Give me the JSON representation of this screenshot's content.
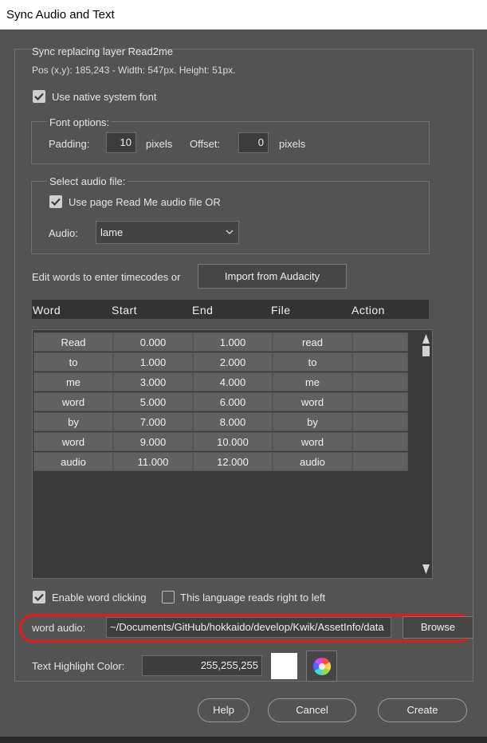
{
  "window": {
    "title": "Sync Audio and Text"
  },
  "layer_info": {
    "title": "Sync replacing layer Read2me",
    "position": "Pos (x,y): 185,243 - Width: 547px. Height: 51px."
  },
  "native_font": {
    "label": "Use native system font",
    "checked": true
  },
  "font_options": {
    "title": "Font options:",
    "padding_label": "Padding:",
    "padding_value": "10",
    "padding_unit": "pixels",
    "offset_label": "Offset:",
    "offset_value": "0",
    "offset_unit": "pixels"
  },
  "audio_file": {
    "title": "Select audio file:",
    "use_page_label": "Use page Read Me audio file OR",
    "use_page_checked": true,
    "audio_label": "Audio:",
    "audio_value": "lame"
  },
  "edit_words": {
    "label": "Edit words to enter timecodes or",
    "import_button": "Import from Audacity"
  },
  "table": {
    "columns": [
      "Word",
      "Start",
      "End",
      "File",
      "Action"
    ],
    "rows": [
      [
        "Read",
        "0.000",
        "1.000",
        "read",
        ""
      ],
      [
        "to",
        "1.000",
        "2.000",
        "to",
        ""
      ],
      [
        "me",
        "3.000",
        "4.000",
        "me",
        ""
      ],
      [
        "word",
        "5.000",
        "6.000",
        "word",
        ""
      ],
      [
        "by",
        "7.000",
        "8.000",
        "by",
        ""
      ],
      [
        "word",
        "9.000",
        "10.000",
        "word",
        ""
      ],
      [
        "audio",
        "11.000",
        "12.000",
        "audio",
        ""
      ]
    ]
  },
  "options": {
    "enable_word_clicking": {
      "label": "Enable word clicking",
      "checked": true
    },
    "right_to_left": {
      "label": "This language reads right to left",
      "checked": false
    }
  },
  "word_audio": {
    "label": "word audio:",
    "value": "~/Documents/GitHub/hokkaido/develop/Kwik/AssetInfo/data",
    "browse_button": "Browse"
  },
  "highlight": {
    "label": "Text Highlight Color:",
    "value": "255,255,255",
    "swatch_color": "#ffffff"
  },
  "footer": {
    "help": "Help",
    "cancel": "Cancel",
    "create": "Create"
  },
  "colors": {
    "background": "#535353",
    "annotation_ring": "#e81818"
  }
}
